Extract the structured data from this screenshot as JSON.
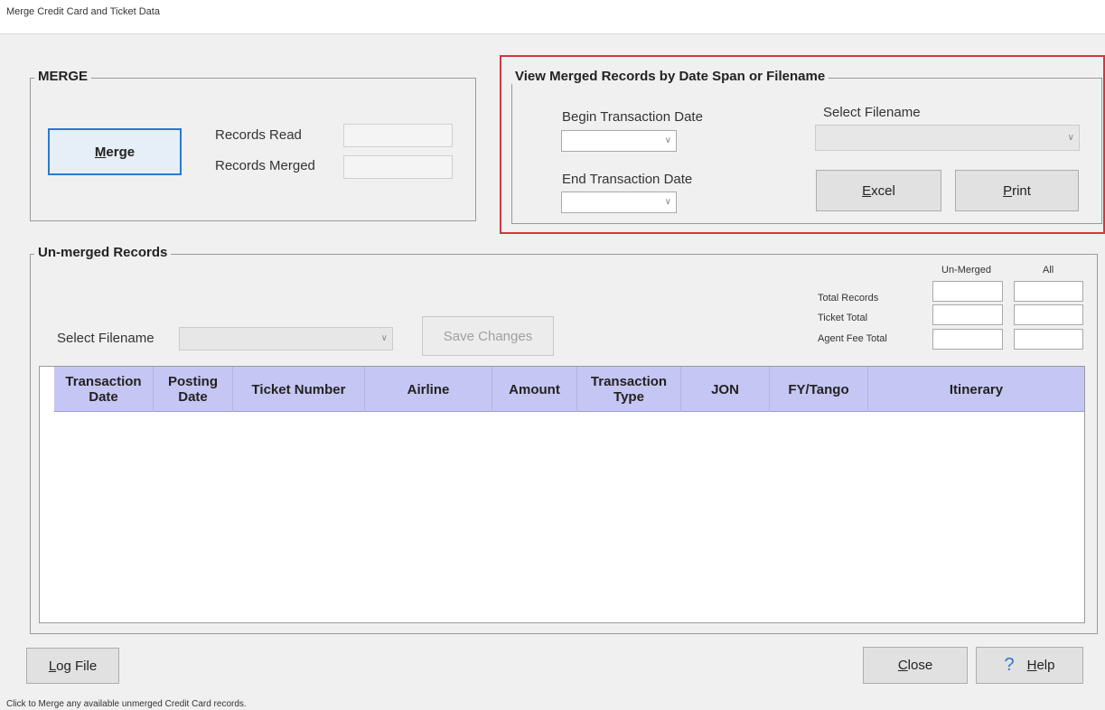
{
  "window": {
    "title": "Merge Credit Card and Ticket Data"
  },
  "merge": {
    "group_title": "MERGE",
    "merge_button_first": "M",
    "merge_button_rest": "erge",
    "records_read_label": "Records Read",
    "records_read_value": "",
    "records_merged_label": "Records Merged",
    "records_merged_value": ""
  },
  "view_merged": {
    "group_title": "View Merged Records by Date Span or Filename",
    "begin_date_label": "Begin Transaction Date",
    "begin_date_value": "",
    "end_date_label": "End Transaction Date",
    "end_date_value": "",
    "select_filename_label": "Select Filename",
    "select_filename_value": "",
    "excel_first": "E",
    "excel_rest": "xcel",
    "print_first": "P",
    "print_rest": "rint",
    "highlight_color": "#d0383f"
  },
  "unmerged": {
    "group_title": "Un-merged Records",
    "select_filename_label": "Select Filename",
    "select_filename_value": "",
    "save_changes_label": "Save Changes",
    "totals": {
      "col_unmerged": "Un-Merged",
      "col_all": "All",
      "rows": [
        {
          "label": "Total Records",
          "unmerged": "",
          "all": ""
        },
        {
          "label": "Ticket Total",
          "unmerged": "",
          "all": ""
        },
        {
          "label": "Agent Fee Total",
          "unmerged": "",
          "all": ""
        }
      ]
    },
    "grid": {
      "header_color": "#c6c6f5",
      "columns": [
        {
          "line1": "Transaction",
          "line2": "Date"
        },
        {
          "line1": "Posting",
          "line2": "Date"
        },
        {
          "line1": "Ticket Number",
          "line2": ""
        },
        {
          "line1": "Airline",
          "line2": ""
        },
        {
          "line1": "Amount",
          "line2": ""
        },
        {
          "line1": "Transaction",
          "line2": "Type"
        },
        {
          "line1": "JON",
          "line2": ""
        },
        {
          "line1": "FY/Tango",
          "line2": ""
        },
        {
          "line1": "Itinerary",
          "line2": ""
        }
      ],
      "rows": []
    }
  },
  "footer": {
    "log_file_first": "L",
    "log_file_rest": "og File",
    "close_first": "C",
    "close_rest": "lose",
    "help_icon": "?",
    "help_first": "H",
    "help_rest": "elp"
  },
  "status": {
    "text": "Click to Merge any available unmerged Credit Card records."
  },
  "icons": [
    "chevron-down-icon",
    "help-question-icon"
  ]
}
